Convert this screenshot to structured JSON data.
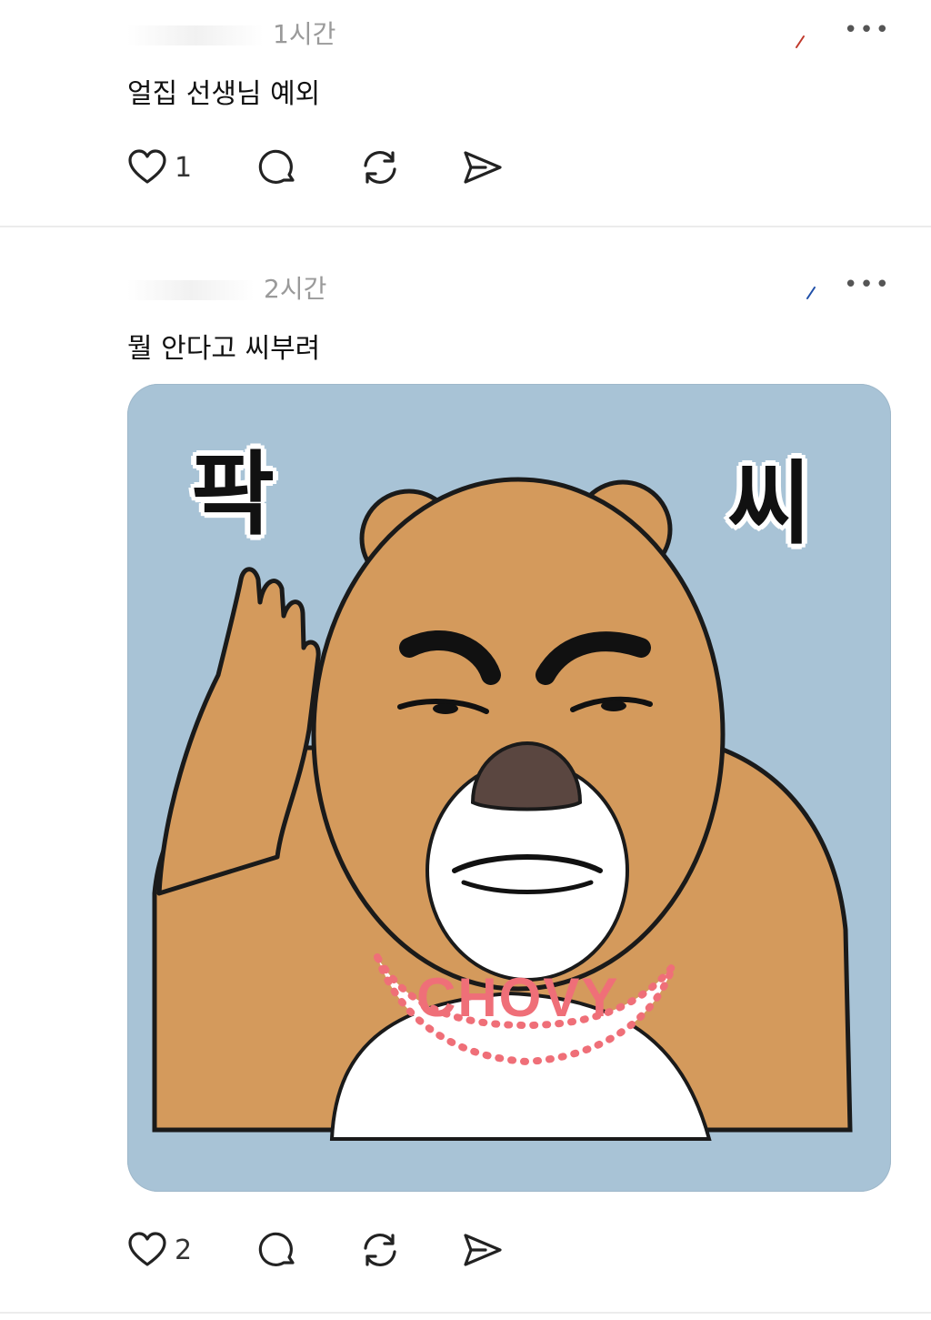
{
  "posts": [
    {
      "time": "1시간",
      "more": "•••",
      "text": "얼집 선생님 예외",
      "likes": "1",
      "reply_icon": "reply-icon",
      "repost_icon": "repost-icon",
      "share_icon": "share-icon"
    },
    {
      "time": "2시간",
      "more": "•••",
      "text": "뭘 안다고 씨부려",
      "likes": "2",
      "image": {
        "caption_left": "팍",
        "caption_right": "씨",
        "bib_text": "CHOVY",
        "background": "#a8c3d6"
      }
    }
  ],
  "colors": {
    "text": "#111111",
    "muted": "#9a9a9a",
    "divider": "#ececec",
    "bear_fur": "#d49a5c"
  }
}
